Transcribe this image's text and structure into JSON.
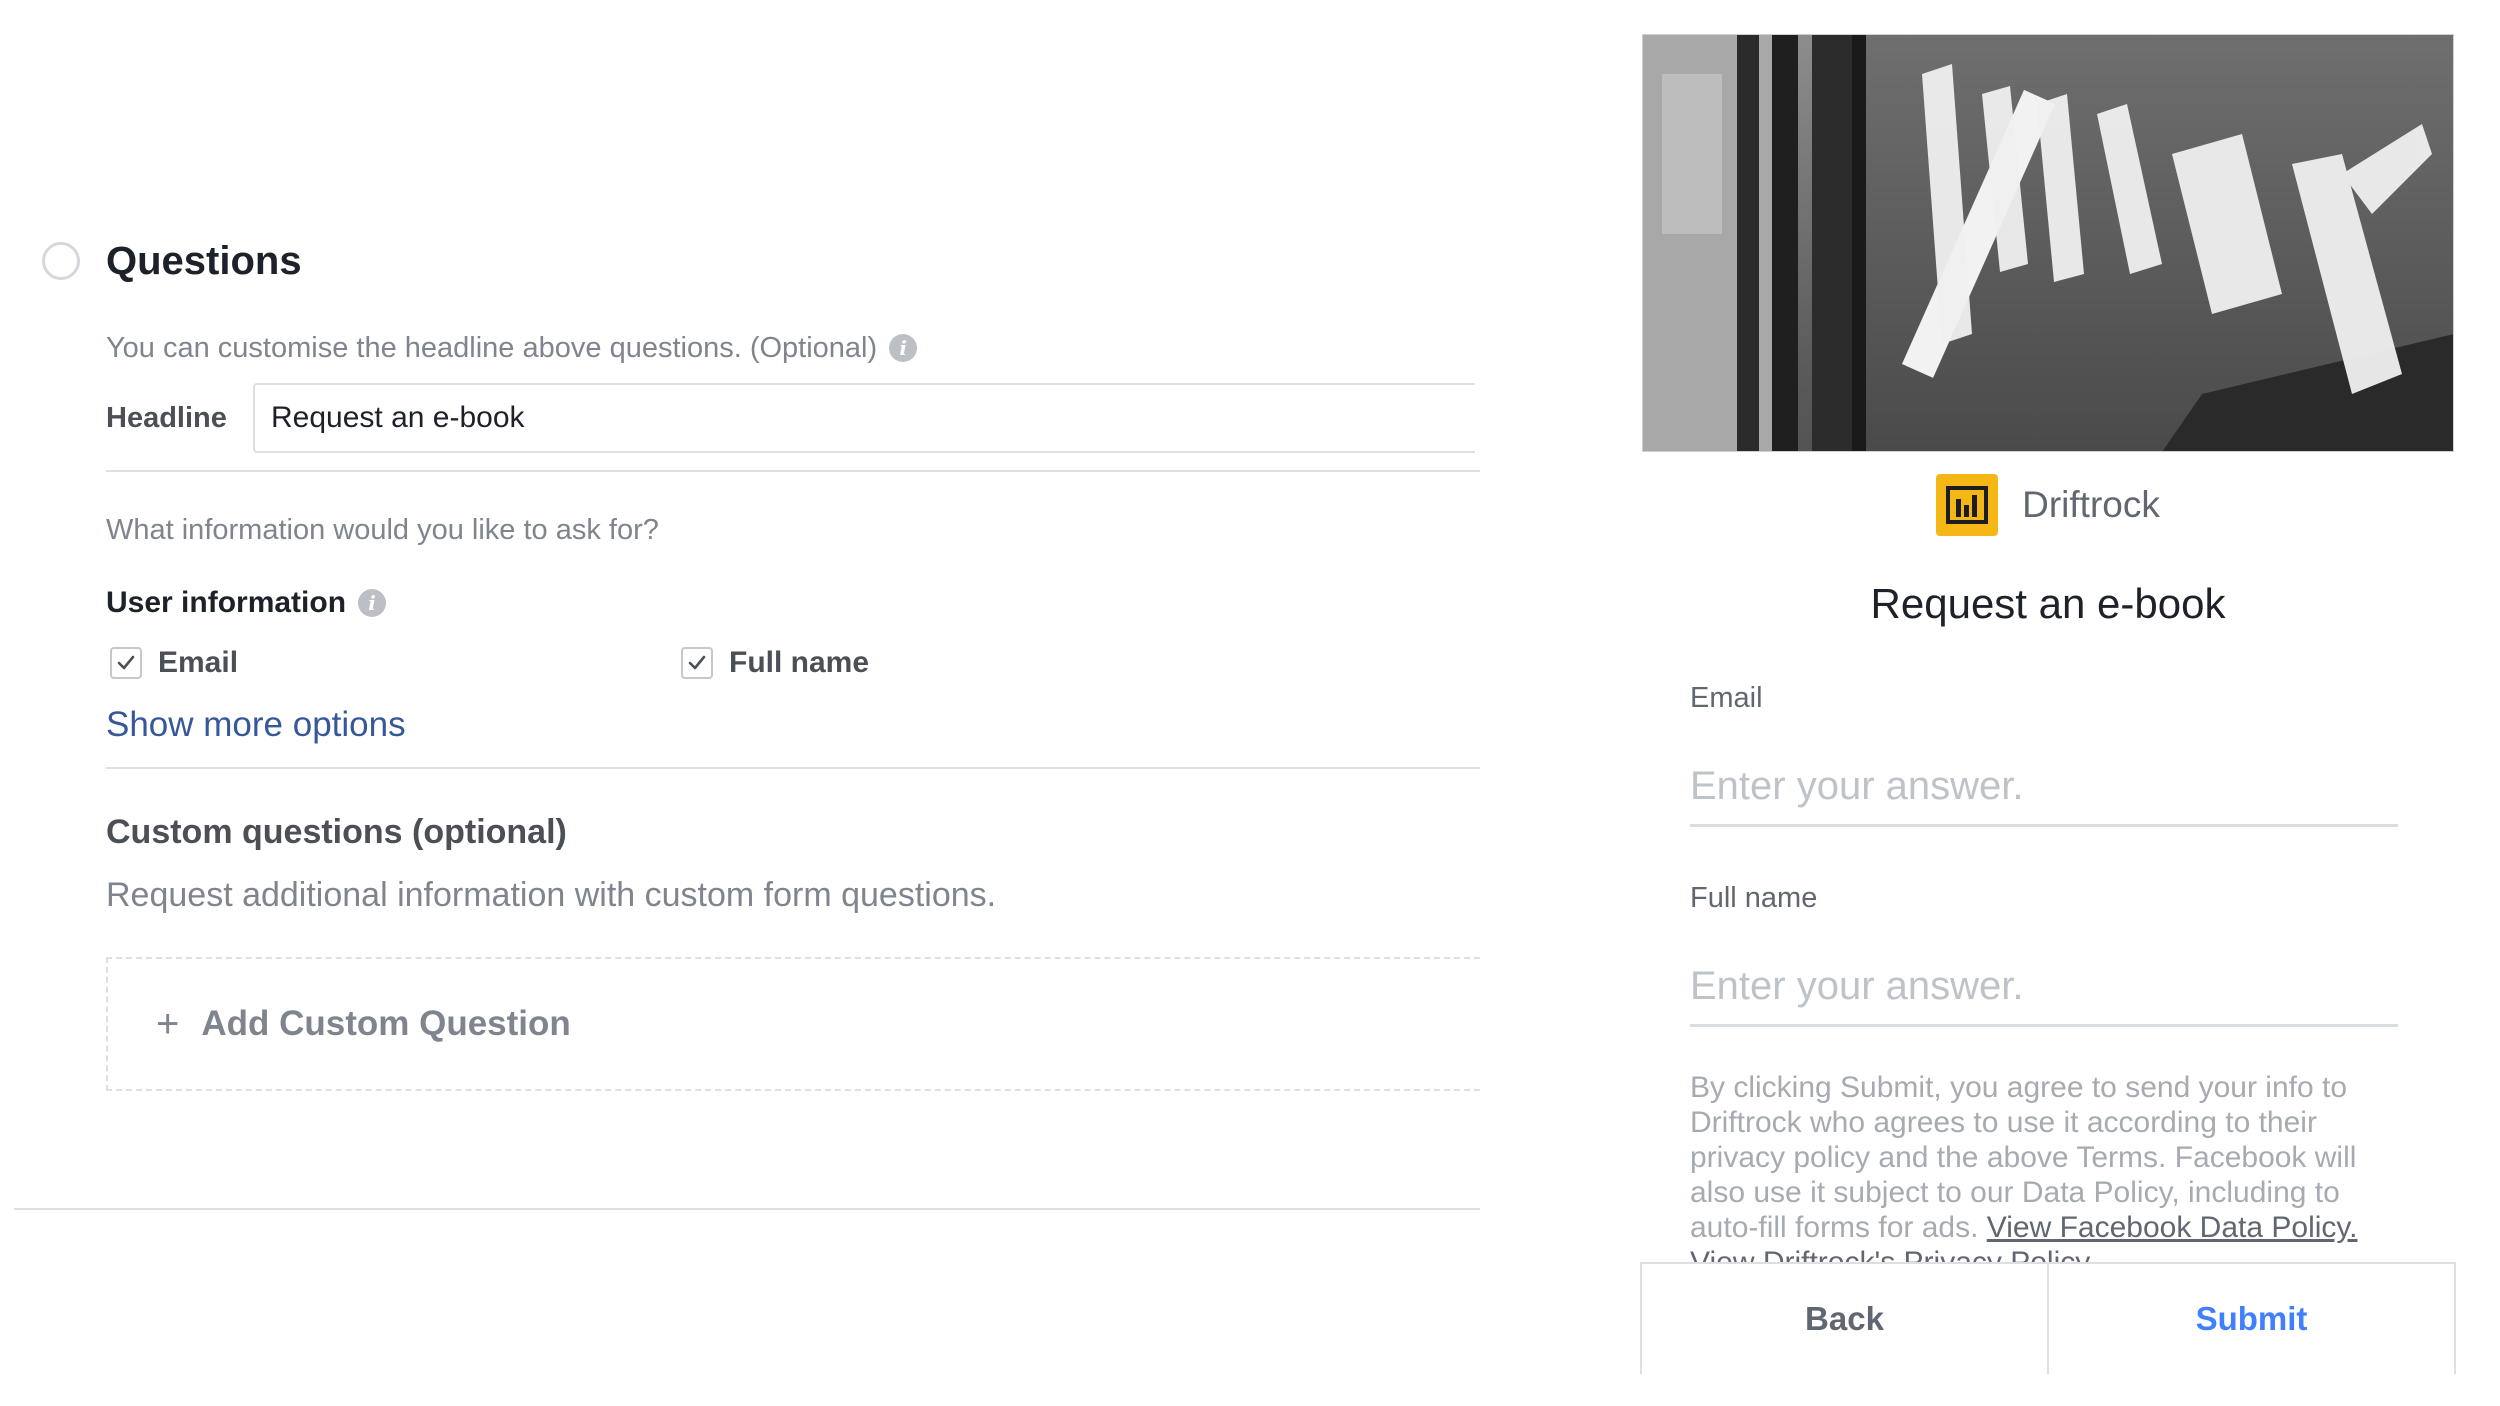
{
  "questions": {
    "title": "Questions",
    "hint": "You can customise the headline above questions. (Optional)",
    "headline_label": "Headline",
    "headline_value": "Request an e-book",
    "prompt": "What information would you like to ask for?",
    "user_info_label": "User information",
    "fields": [
      {
        "label": "Email",
        "checked": true
      },
      {
        "label": "Full name",
        "checked": true
      }
    ],
    "show_more": "Show more options",
    "custom_title": "Custom questions (optional)",
    "custom_desc": "Request additional information with custom form questions.",
    "add_custom": "Add Custom Question"
  },
  "preview": {
    "brand_name": "Driftrock",
    "title": "Request an e-book",
    "fields": [
      {
        "label": "Email",
        "placeholder": "Enter your answer."
      },
      {
        "label": "Full name",
        "placeholder": "Enter your answer."
      }
    ],
    "disclaimer": "By clicking Submit, you agree to send your info to Driftrock who agrees to use it according to their privacy policy and the above Terms. Facebook will also use it subject to our Data Policy, including to auto-fill forms for ads. ",
    "disclaimer_link": "View Facebook Data Policy. View Driftrock's Privacy Policy.",
    "back_label": "Back",
    "submit_label": "Submit"
  },
  "colors": {
    "link_blue": "#365899",
    "submit_blue": "#4080ff",
    "brand_yellow": "#f5b716",
    "muted_text": "#7f858e"
  }
}
